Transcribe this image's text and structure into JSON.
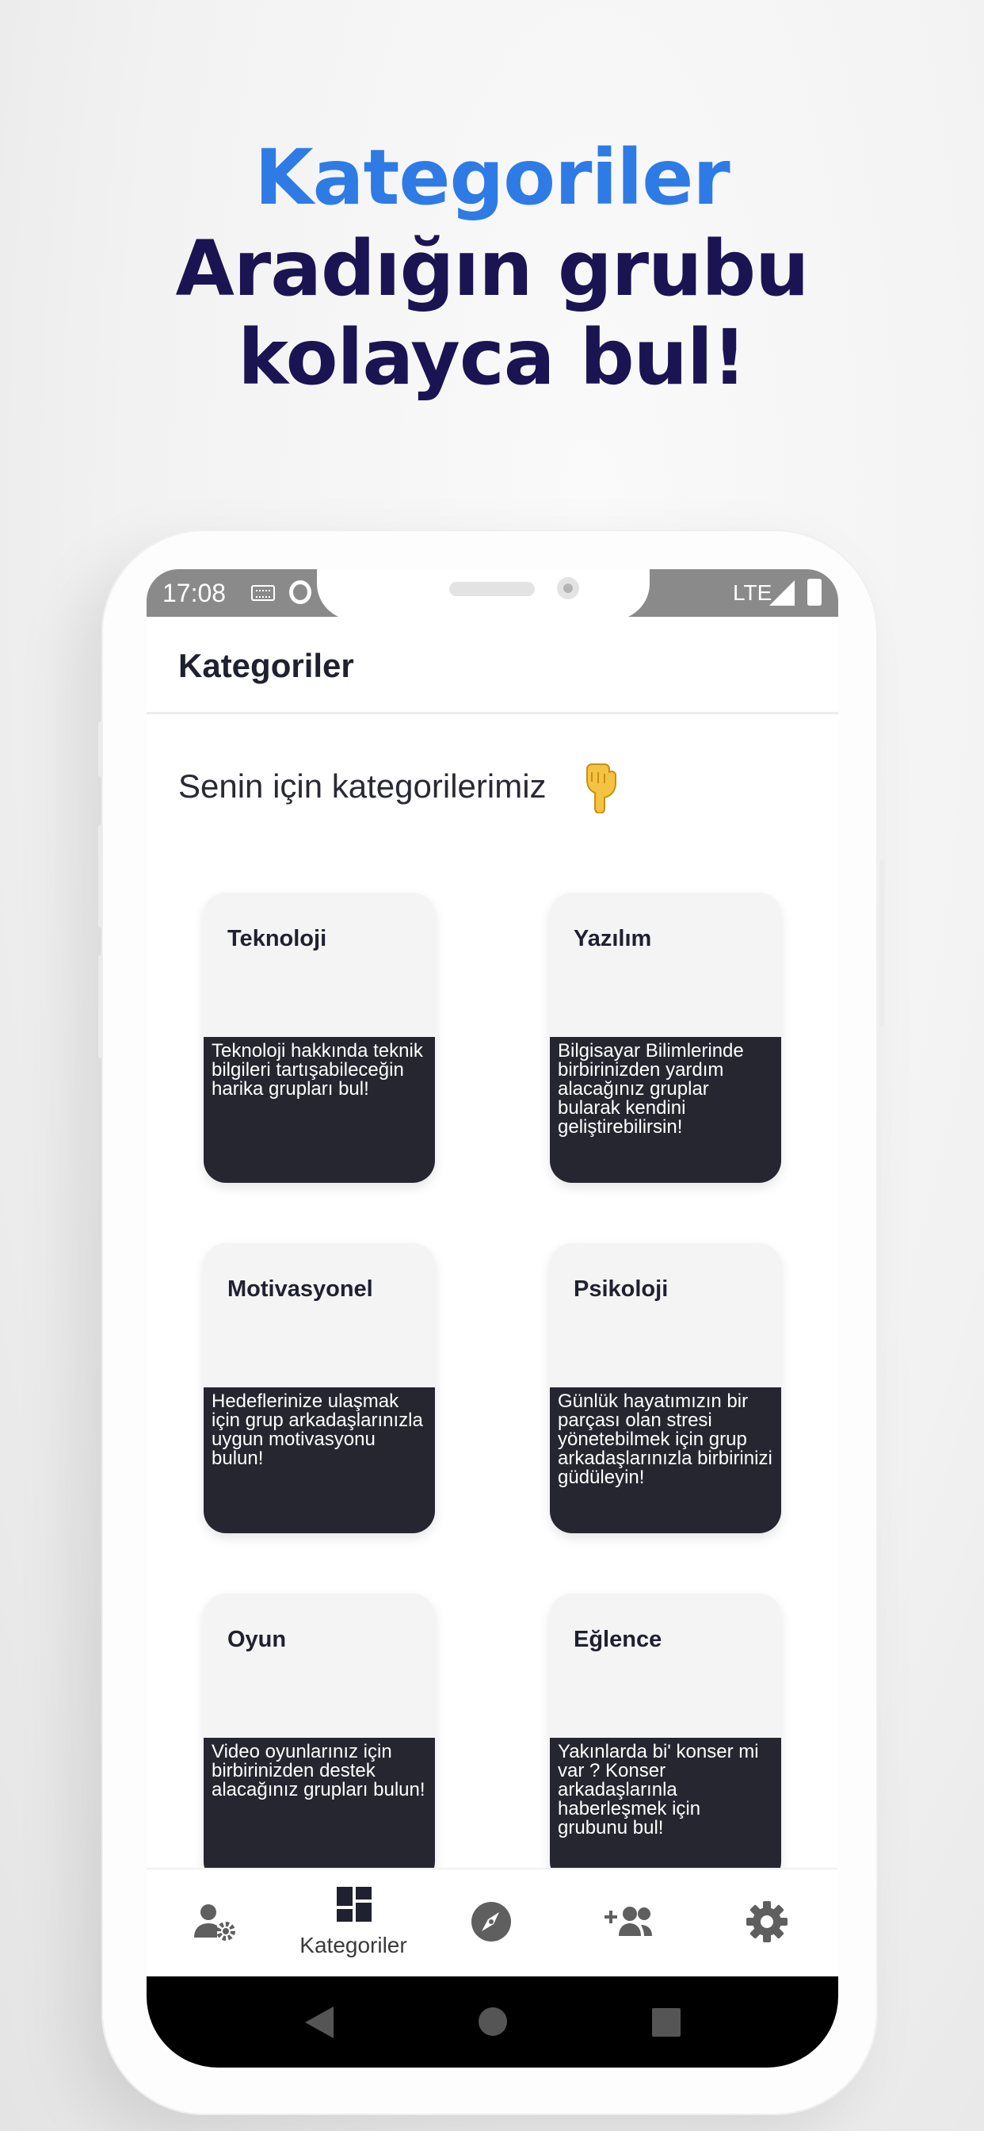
{
  "promo": {
    "line1": "Kategoriler",
    "line2": "Aradığın grubu",
    "line3": "kolayca bul!"
  },
  "status_bar": {
    "time": "17:08",
    "network": "LTE",
    "icons": [
      "keyboard-icon",
      "notification-ring-icon",
      "signal-icon",
      "battery-icon"
    ]
  },
  "app_bar": {
    "title": "Kategoriler"
  },
  "section": {
    "title": "Senin için kategorilerimiz",
    "emoji_icon": "pointing-down-hand-icon"
  },
  "categories": [
    {
      "title": "Teknoloji",
      "description": "Teknoloji hakkında teknik bilgileri tartışabileceğin harika grupları bul!"
    },
    {
      "title": "Yazılım",
      "description": "Bilgisayar Bilimlerinde birbirinizden yardım alacağınız gruplar bularak kendini geliştirebilirsin!"
    },
    {
      "title": "Motivasyonel",
      "description": "Hedeflerinize ulaşmak için grup arkadaşlarınızla uygun motivasyonu bulun!"
    },
    {
      "title": "Psikoloji",
      "description": "Günlük hayatımızın bir parçası olan stresi yönetebilmek için grup arkadaşlarınızla birbirinizi güdüleyin!"
    },
    {
      "title": "Oyun",
      "description": "Video oyunlarınız için birbirinizden destek alacağınız grupları bulun!"
    },
    {
      "title": "Eğlence",
      "description": "Yakınlarda bi' konser mi var ? Konser arkadaşlarınla haberleşmek için grubunu bul!"
    }
  ],
  "bottom_nav": {
    "items": [
      {
        "icon": "user-settings-icon",
        "label": ""
      },
      {
        "icon": "dashboard-icon",
        "label": "Kategoriler",
        "active": true
      },
      {
        "icon": "compass-icon",
        "label": ""
      },
      {
        "icon": "add-group-icon",
        "label": ""
      },
      {
        "icon": "settings-gear-icon",
        "label": ""
      }
    ]
  },
  "colors": {
    "promo_accent": "#2f7be5",
    "promo_dark": "#1b1452",
    "card_bottom": "#262631",
    "card_top": "#f4f4f5",
    "status_bar": "#8a8a8a",
    "nav_icon": "#5f5f5f"
  }
}
